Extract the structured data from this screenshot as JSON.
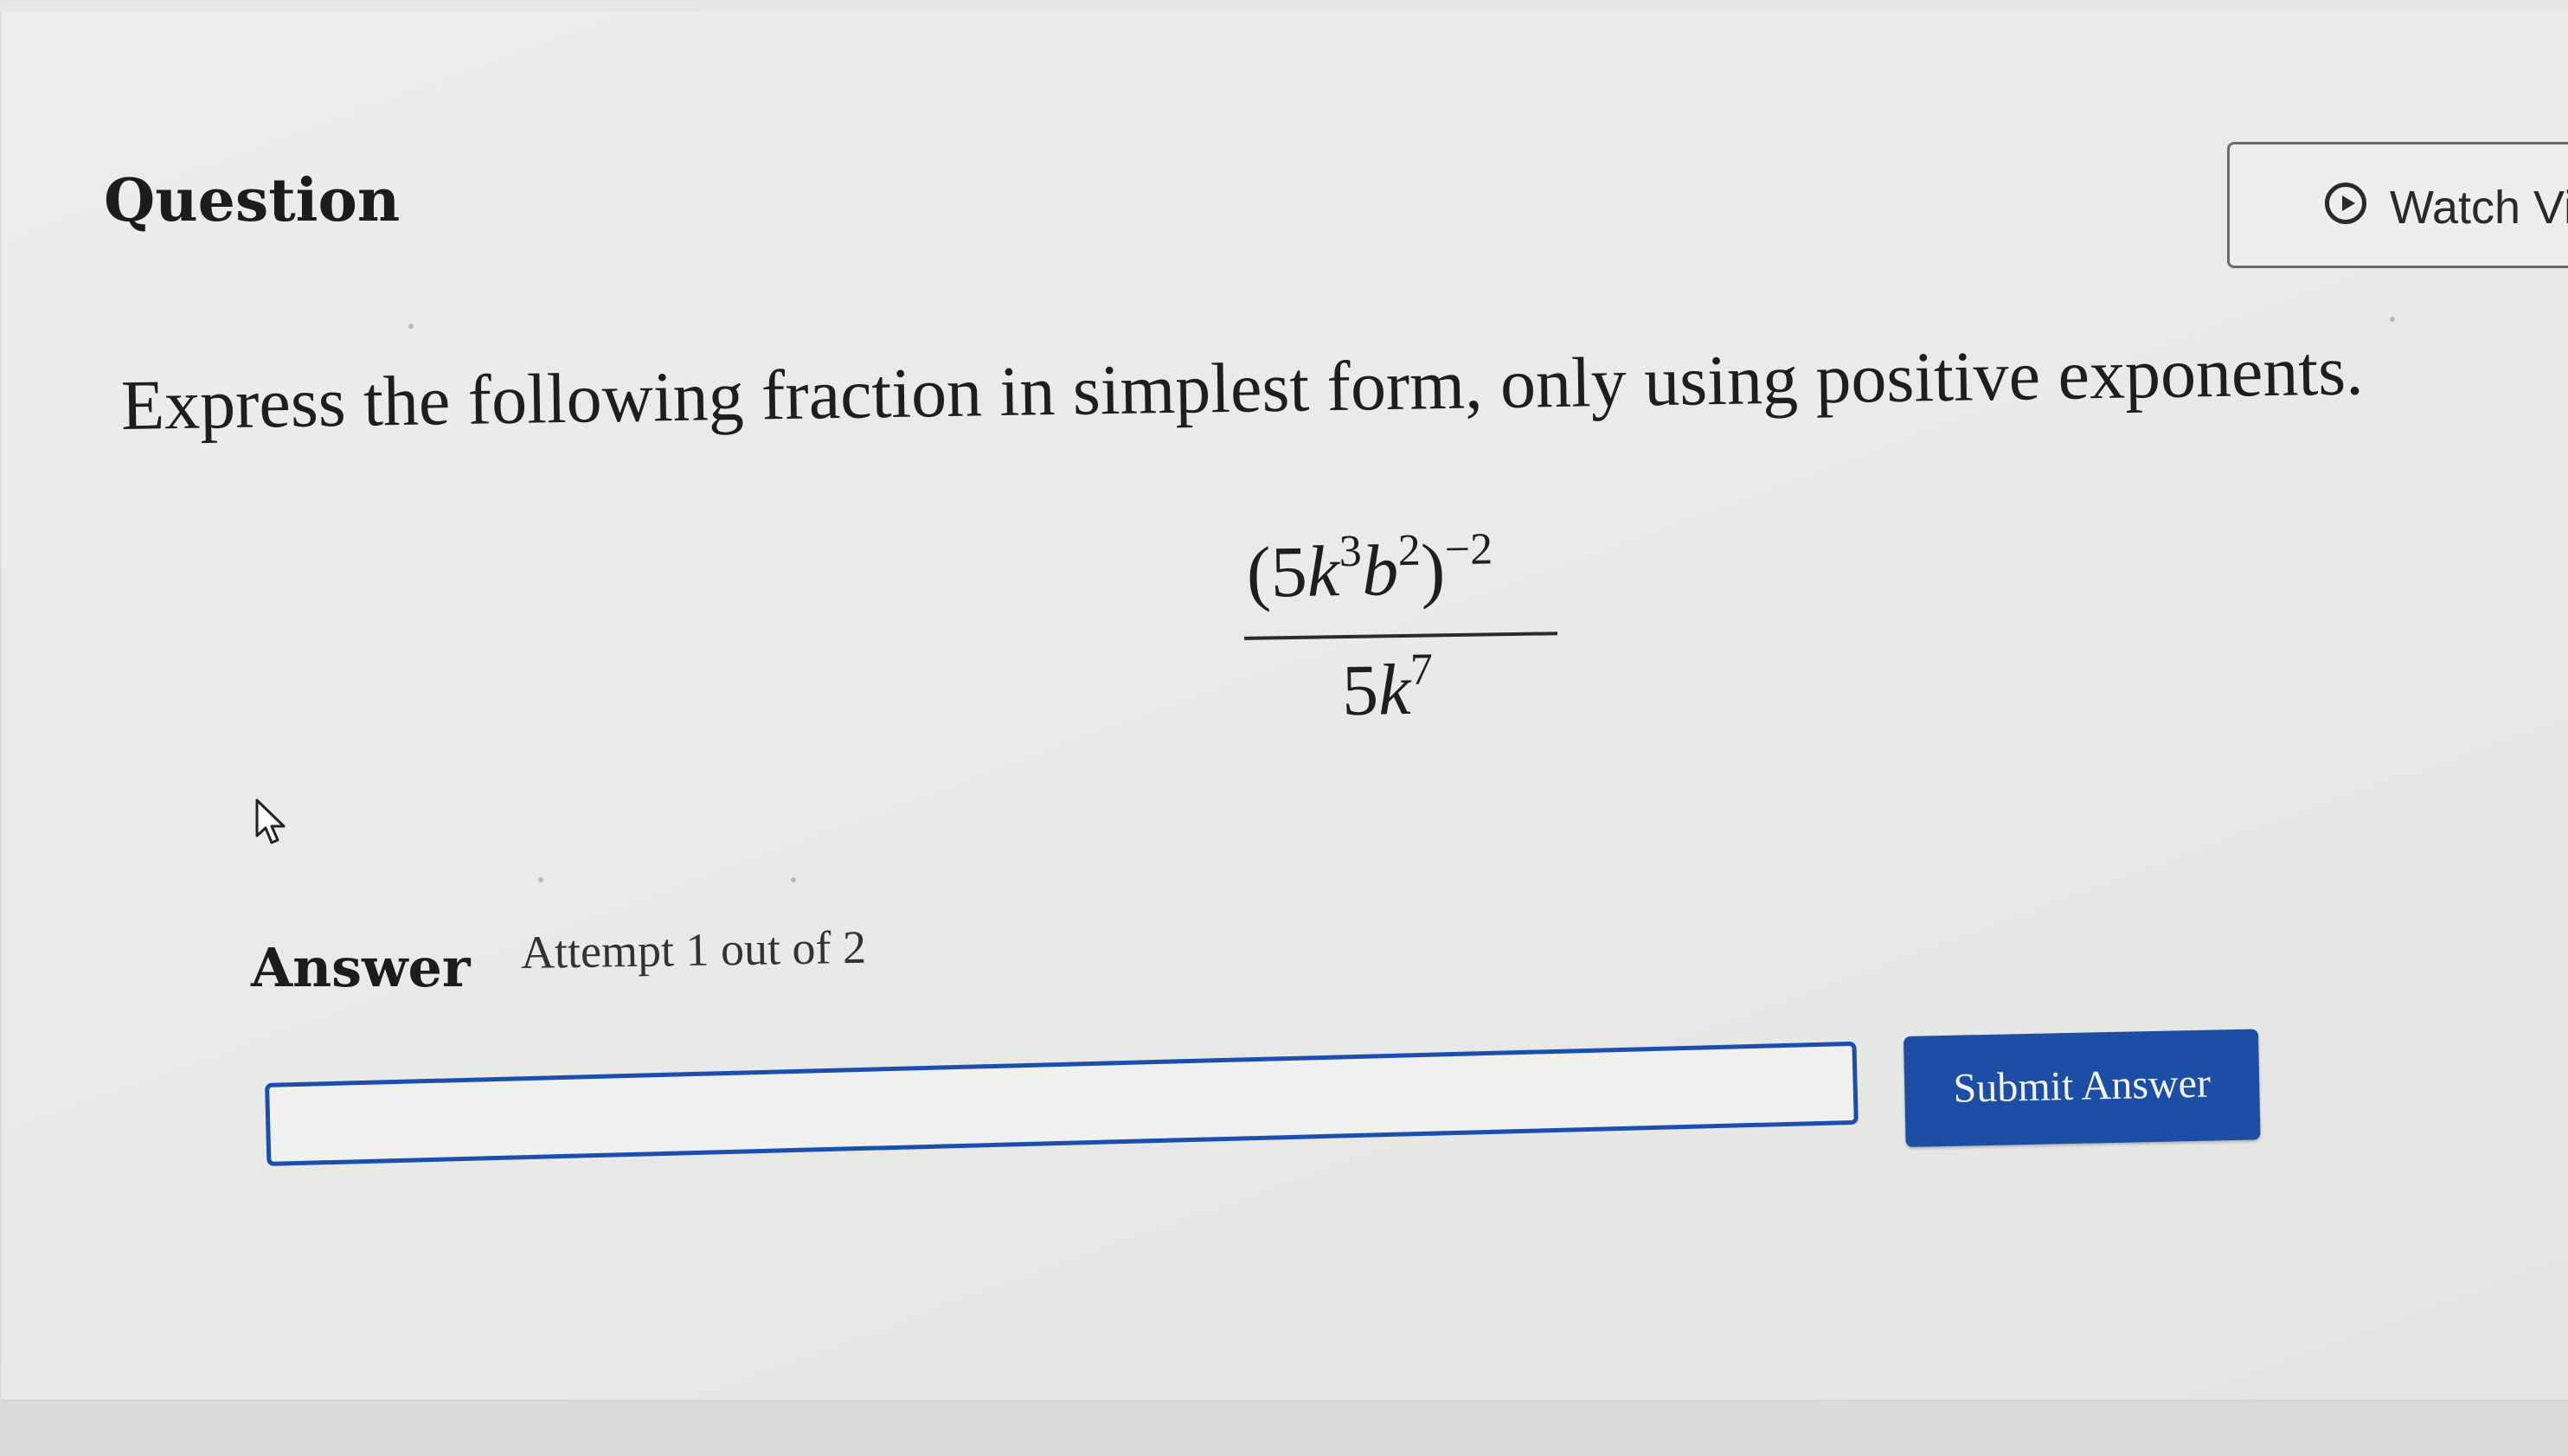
{
  "question": {
    "heading": "Question",
    "watch_video_label": "Watch Vi",
    "prompt": "Express the following fraction in simplest form, only using positive exponents.",
    "expression": {
      "numerator_open": "(5",
      "var_k": "k",
      "k_exp": "3",
      "var_b": "b",
      "b_exp": "2",
      "numerator_close": ")",
      "outer_exp": "−2",
      "denominator_coef": "5",
      "denominator_exp": "7"
    }
  },
  "answer": {
    "label": "Answer",
    "attempt_text": "Attempt 1 out of 2",
    "input_value": "",
    "submit_label": "Submit Answer"
  },
  "colors": {
    "accent_blue": "#1d4ea6",
    "input_border": "#1a4fb0",
    "background": "#e9e9e7"
  },
  "icons": {
    "watch": "play-circle-icon",
    "cursor": "mouse-pointer-icon"
  }
}
